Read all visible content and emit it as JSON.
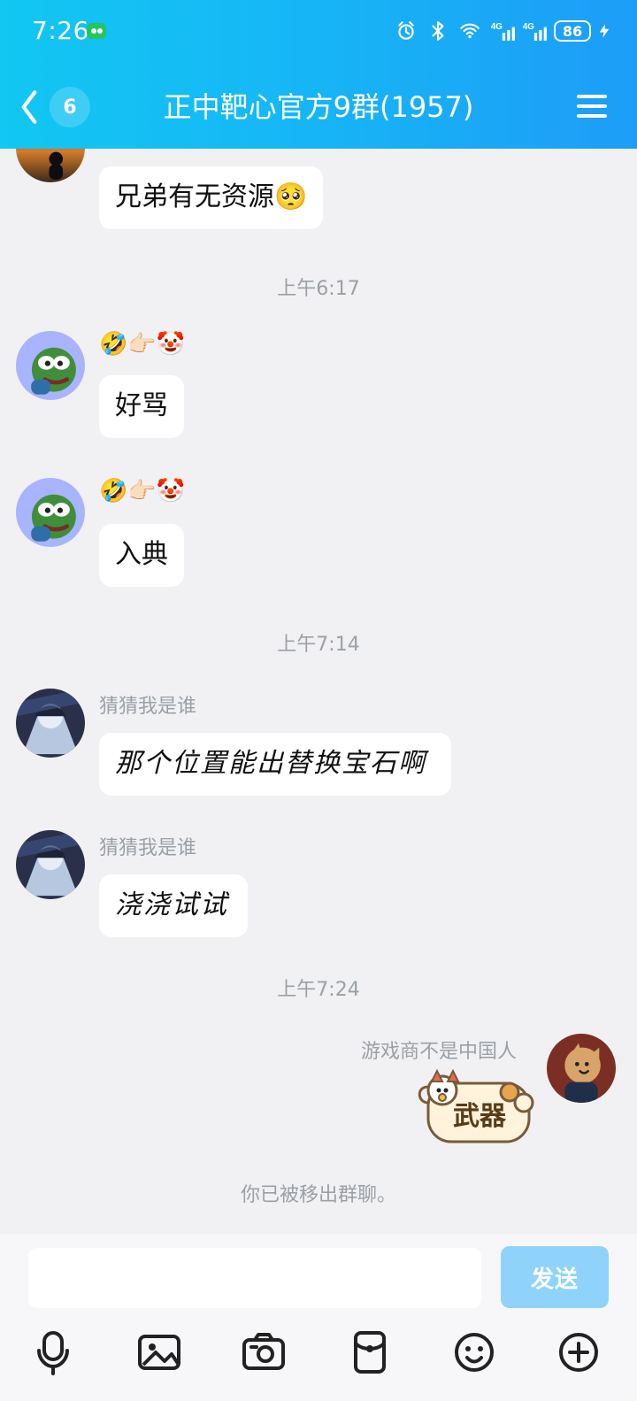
{
  "status_bar": {
    "time": "7:26",
    "battery": "86"
  },
  "header": {
    "back_count": "6",
    "title": "正中靶心官方9群(1957)"
  },
  "messages": [
    {
      "type": "incoming",
      "text": "兄弟有无资源🥺"
    },
    {
      "type": "time",
      "text": "上午6:17"
    },
    {
      "type": "incoming",
      "sender_emoji": "🤣👉🏻🤡",
      "text": "好骂"
    },
    {
      "type": "incoming",
      "sender_emoji": "🤣👉🏻🤡",
      "text": "入典"
    },
    {
      "type": "time",
      "text": "上午7:14"
    },
    {
      "type": "incoming",
      "sender": "猜猜我是谁",
      "text": "那个位置能出替换宝石啊"
    },
    {
      "type": "incoming",
      "sender": "猜猜我是谁",
      "text": "浇浇试试"
    },
    {
      "type": "time",
      "text": "上午7:24"
    },
    {
      "type": "outgoing",
      "sender": "游戏商不是中国人",
      "sticker_text": "武器"
    },
    {
      "type": "system",
      "text": "你已被移出群聊。"
    }
  ],
  "input": {
    "send_label": "发送"
  },
  "icons": {
    "back": "chevron-left-icon",
    "menu": "hamburger-menu-icon",
    "mic": "microphone-icon",
    "image": "image-icon",
    "camera": "camera-icon",
    "red_packet": "red-packet-icon",
    "emoji": "emoji-icon",
    "plus": "plus-icon"
  },
  "colors": {
    "header_start": "#12c7f2",
    "header_end": "#1d9df7",
    "chat_bg": "#f1f1f3",
    "send_disabled": "#8fd3fb"
  }
}
